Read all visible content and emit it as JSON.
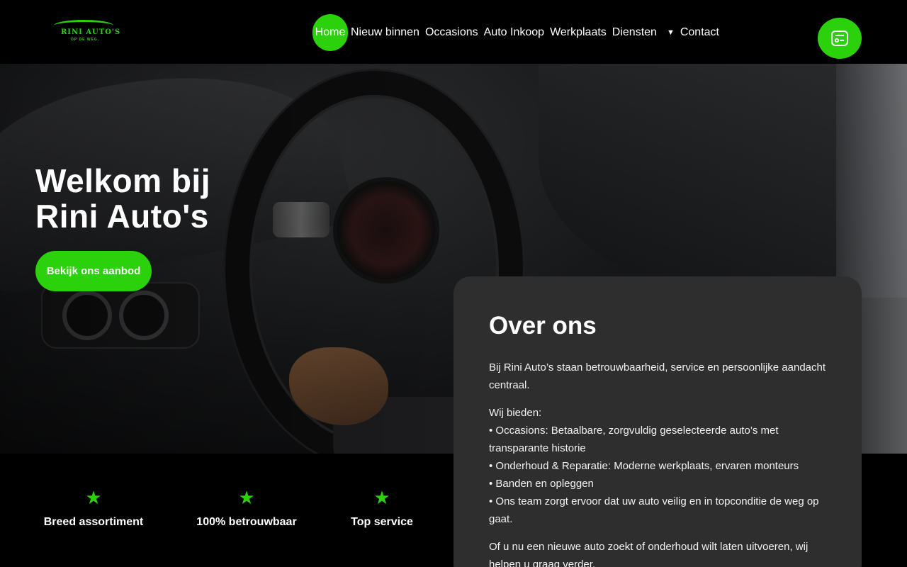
{
  "brand": {
    "logo_text": "RINI AUTO'S",
    "logo_tagline": "OP DE WEG.",
    "accent_color": "#2bd10a"
  },
  "nav": {
    "items": [
      {
        "label": "Home",
        "active": true
      },
      {
        "label": "Nieuw binnen"
      },
      {
        "label": "Occasions"
      },
      {
        "label": "Auto Inkoop"
      },
      {
        "label": "Werkplaats"
      },
      {
        "label": "Diensten",
        "dropdown": true
      },
      {
        "label": "Contact"
      }
    ],
    "dropdown_icon": "caret-down-icon"
  },
  "floating_button": {
    "icon": "contact-card-icon"
  },
  "hero": {
    "title_line1": "Welkom bij",
    "title_line2": "Rini Auto's",
    "button_label": "Bekijk ons aanbod"
  },
  "features": [
    {
      "icon": "star-icon",
      "label": "Breed assortiment"
    },
    {
      "icon": "star-icon",
      "label": "100% betrouwbaar"
    },
    {
      "icon": "star-icon",
      "label": "Top service"
    }
  ],
  "about": {
    "title": "Over ons",
    "intro": "Bij Rini Auto’s staan betrouwbaarheid, service en persoonlijke aandacht centraal.",
    "list_heading": "Wij bieden:",
    "list": [
      "• Occasions: Betaalbare, zorgvuldig geselecteerde auto’s met transparante historie",
      "• Onderhoud & Reparatie: Moderne werkplaats, ervaren monteurs",
      "• Banden en opleggen",
      "• Ons team zorgt ervoor dat uw auto veilig en in topconditie de weg op gaat."
    ],
    "closing": "Of u nu een nieuwe auto zoekt of onderhoud wilt laten uitvoeren, wij helpen u graag verder."
  }
}
